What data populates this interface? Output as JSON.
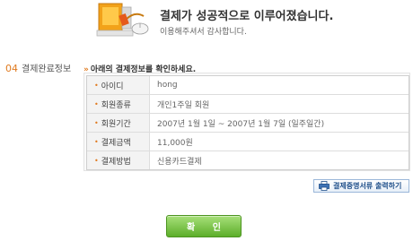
{
  "header": {
    "title": "결제가 성공적으로 이루어졌습니다.",
    "subtitle": "이용해주셔서 감사합니다."
  },
  "section": {
    "number": "04",
    "label": "결제완료정보"
  },
  "instruction": {
    "arrow": "»",
    "text": "아래의 결제정보를 확인하세요."
  },
  "table": {
    "rows": [
      {
        "key": "아이디",
        "value": "hong"
      },
      {
        "key": "회원종류",
        "value": "개인1주일 회원"
      },
      {
        "key": "회원기간",
        "value": "2007년 1월 1일 ~ 2007년 1월 7일 (일주일간)"
      },
      {
        "key": "결제금액",
        "value": "11,000원"
      },
      {
        "key": "결제방법",
        "value": "신용카드결제"
      }
    ]
  },
  "buttons": {
    "print_receipt": "결제증명서류 출력하기",
    "confirm": "확 인"
  },
  "colors": {
    "accent_orange": "#e07a1f",
    "confirm_green": "#5cae2a",
    "print_blue": "#1f4f8a"
  }
}
